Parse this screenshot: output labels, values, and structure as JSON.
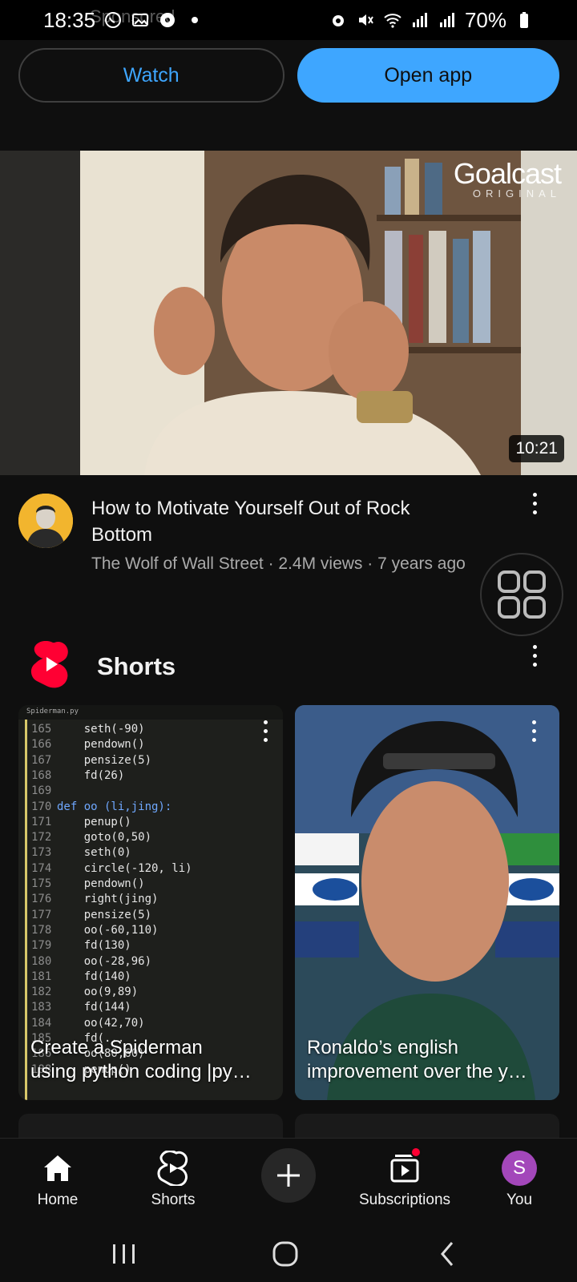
{
  "status_bar": {
    "time": "18:35",
    "battery": "70%",
    "icons": [
      "whatsapp-icon",
      "gallery-icon",
      "football-icon",
      "dot-icon",
      "alarm-icon",
      "mute-icon",
      "wifi-icon",
      "signal-icon",
      "signal-icon",
      "battery-icon"
    ]
  },
  "ad": {
    "ghost_label": "Sponsored",
    "watch_label": "Watch",
    "open_app_label": "Open app"
  },
  "video": {
    "brand_main": "Goalcast",
    "brand_sub": "ORIGINAL",
    "duration": "10:21",
    "title_line1": "How to Motivate Yourself Out of Rock",
    "title_line2": "Bottom",
    "meta": "The Wolf of Wall Street · 2.4M views · 7 years ago"
  },
  "shorts": {
    "section_title": "Shorts",
    "items": [
      {
        "caption_line1": "Create a Spiderman",
        "caption_line2": "using python coding |py…",
        "tab_name": "Spiderman.py",
        "code_lines": [
          {
            "n": "165",
            "t": "    seth(-90)"
          },
          {
            "n": "166",
            "t": "    pendown()"
          },
          {
            "n": "167",
            "t": "    pensize(5)"
          },
          {
            "n": "168",
            "t": "    fd(26)"
          },
          {
            "n": "169",
            "t": ""
          },
          {
            "n": "170",
            "t": "def oo (li,jing):"
          },
          {
            "n": "171",
            "t": "    penup()"
          },
          {
            "n": "172",
            "t": "    goto(0,50)"
          },
          {
            "n": "173",
            "t": "    seth(0)"
          },
          {
            "n": "174",
            "t": "    circle(-120, li)"
          },
          {
            "n": "175",
            "t": "    pendown()"
          },
          {
            "n": "176",
            "t": "    right(jing)"
          },
          {
            "n": "177",
            "t": "    pensize(5)"
          },
          {
            "n": "178",
            "t": "    oo(-60,110)"
          },
          {
            "n": "179",
            "t": "    fd(130)"
          },
          {
            "n": "180",
            "t": "    oo(-28,96)"
          },
          {
            "n": "181",
            "t": "    fd(140)"
          },
          {
            "n": "182",
            "t": "    oo(9,89)"
          },
          {
            "n": "183",
            "t": "    fd(144)"
          },
          {
            "n": "184",
            "t": "    oo(42,70)"
          },
          {
            "n": "185",
            "t": "    fd(..."
          },
          {
            "n": "186",
            "t": "    oo(80,60)"
          },
          {
            "n": "188",
            "t": "    penup()"
          }
        ]
      },
      {
        "caption_line1": "Ronaldo’s english",
        "caption_line2": "improvement over the y…"
      }
    ]
  },
  "bottom_nav": {
    "home": "Home",
    "shorts": "Shorts",
    "subscriptions": "Subscriptions",
    "you": "You",
    "you_initial": "S"
  },
  "colors": {
    "accent_blue": "#3ea6ff",
    "background": "#0f0f0f",
    "shorts_red": "#ff0033",
    "avatar_purple": "#a347ba"
  }
}
